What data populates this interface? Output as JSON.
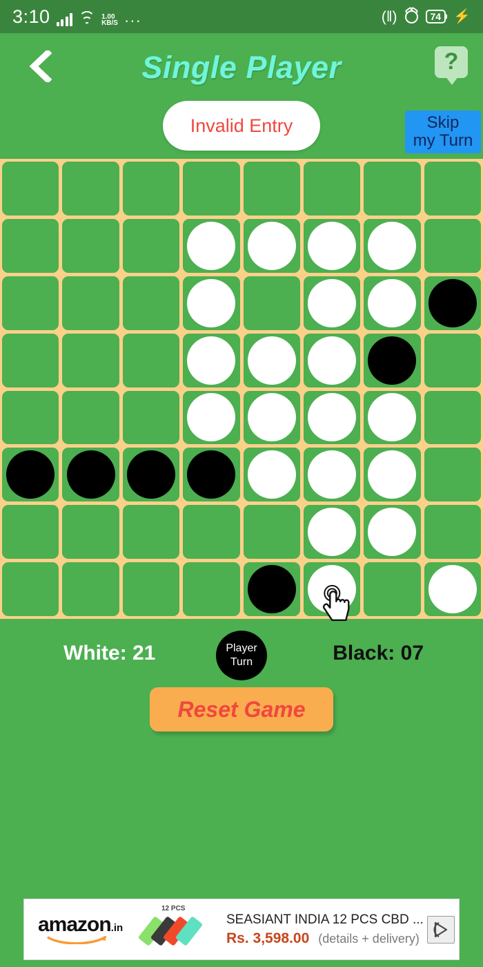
{
  "statusbar": {
    "clock": "3:10",
    "net_speed_value": "1.00",
    "net_speed_unit": "KB/S",
    "overflow_dots": "···",
    "vibrate_icon": "(‖)",
    "battery_level": "74",
    "charging_icon": "⚡",
    "bg_color": "#3A853E"
  },
  "header": {
    "back_icon": "chevron-left",
    "title": "Single Player",
    "title_color": "#6FF5DC",
    "help_icon_label": "?"
  },
  "toast": {
    "message": "Invalid Entry",
    "text_color": "#F0473E"
  },
  "skip": {
    "line1": "Skip",
    "line2": "my Turn",
    "bg_color": "#2196F3"
  },
  "board": {
    "rows": 8,
    "cols": 8,
    "cell_color": "#4CAF50",
    "grid_color": "#FBD18A",
    "cursor_cell": {
      "row": 7,
      "col": 5
    },
    "cells": [
      [
        "",
        "",
        "",
        "",
        "",
        "",
        "",
        ""
      ],
      [
        "",
        "",
        "",
        "white",
        "white",
        "white",
        "white",
        ""
      ],
      [
        "",
        "",
        "",
        "white",
        "",
        "white",
        "white",
        "black"
      ],
      [
        "",
        "",
        "",
        "white",
        "white",
        "white",
        "black",
        ""
      ],
      [
        "",
        "",
        "",
        "white",
        "white",
        "white",
        "white",
        ""
      ],
      [
        "black",
        "black",
        "black",
        "black",
        "white",
        "white",
        "white",
        ""
      ],
      [
        "",
        "",
        "",
        "",
        "",
        "white",
        "white",
        ""
      ],
      [
        "",
        "",
        "",
        "",
        "black",
        "white",
        "",
        "white"
      ]
    ]
  },
  "score": {
    "white_label": "White: 21",
    "black_label": "Black: 07",
    "turn_line1": "Player",
    "turn_line2": "Turn"
  },
  "reset": {
    "label": "Reset Game",
    "bg_color": "#FAAD4F",
    "text_color": "#F0473E"
  },
  "ad": {
    "brand": "amazon",
    "brand_suffix": ".in",
    "pcs_label": "12 PCS",
    "title": "SEASIANT INDIA 12 PCS CBD ...",
    "price": "Rs. 3,598.00",
    "delivery": "(details + delivery)",
    "adchoices_icon": "adchoices"
  }
}
